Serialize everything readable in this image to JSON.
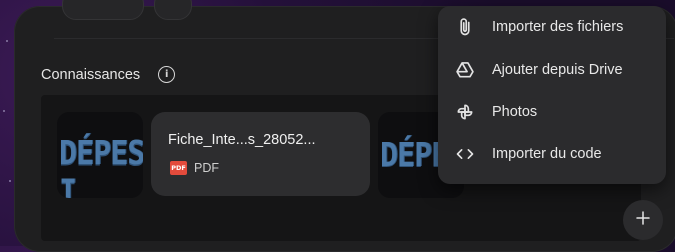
{
  "section": {
    "title": "Connaissances"
  },
  "file_card": {
    "name": "Fiche_Inte...s_28052...",
    "type_label": "PDF",
    "badge": "PDF"
  },
  "menu": {
    "items": [
      {
        "label": "Importer des fichiers",
        "icon": "paperclip-icon"
      },
      {
        "label": "Ajouter depuis Drive",
        "icon": "drive-icon"
      },
      {
        "label": "Photos",
        "icon": "photos-pinwheel-icon"
      },
      {
        "label": "Importer du code",
        "icon": "code-icon"
      }
    ]
  },
  "thumbnails": [
    {
      "text": "DÉPES I"
    },
    {
      "text": "DÉPES"
    }
  ],
  "colors": {
    "panel_bg": "#1f1f20",
    "menu_bg": "#2b2b2d",
    "pdf_badge": "#e34b3c",
    "card_bg": "#2d2d2f"
  }
}
